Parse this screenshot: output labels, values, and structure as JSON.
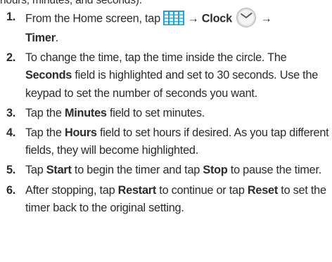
{
  "intro": "hours, minutes, and seconds).",
  "steps": [
    {
      "num": "1.",
      "a": "From the Home screen, tap",
      "arrow1": "→",
      "clock": "Clock",
      "arrow2": "→",
      "timer": "Timer",
      "end": ".",
      "icons": [
        "apps-grid-icon",
        "clock-icon"
      ]
    },
    {
      "num": "2.",
      "a": "To change the time, tap the time inside the circle. The ",
      "seconds": "Seconds",
      "b": " field is highlighted and set to 30 seconds. Use the keypad to set the number of seconds you want."
    },
    {
      "num": "3.",
      "a": "Tap the ",
      "minutes": "Minutes",
      "b": " field to set minutes."
    },
    {
      "num": "4.",
      "a": "Tap the ",
      "hours": "Hours",
      "b": " field to set hours if desired. As you tap different fields, they will become highlighted."
    },
    {
      "num": "5.",
      "a": "Tap ",
      "start": "Start",
      "b": " to begin the timer and tap ",
      "stop": "Stop",
      "c": " to pause the timer."
    },
    {
      "num": "6.",
      "a": "After stopping, tap ",
      "restart": "Restart",
      "b": " to continue or tap ",
      "reset": "Reset",
      "c": " to set the timer back to the original setting."
    }
  ],
  "colors": {
    "text": "#2b2b2b",
    "grid_icon": "#1aa3d9",
    "clock_icon_bg": "#dcdcdc",
    "clock_icon_hands": "#555555"
  }
}
